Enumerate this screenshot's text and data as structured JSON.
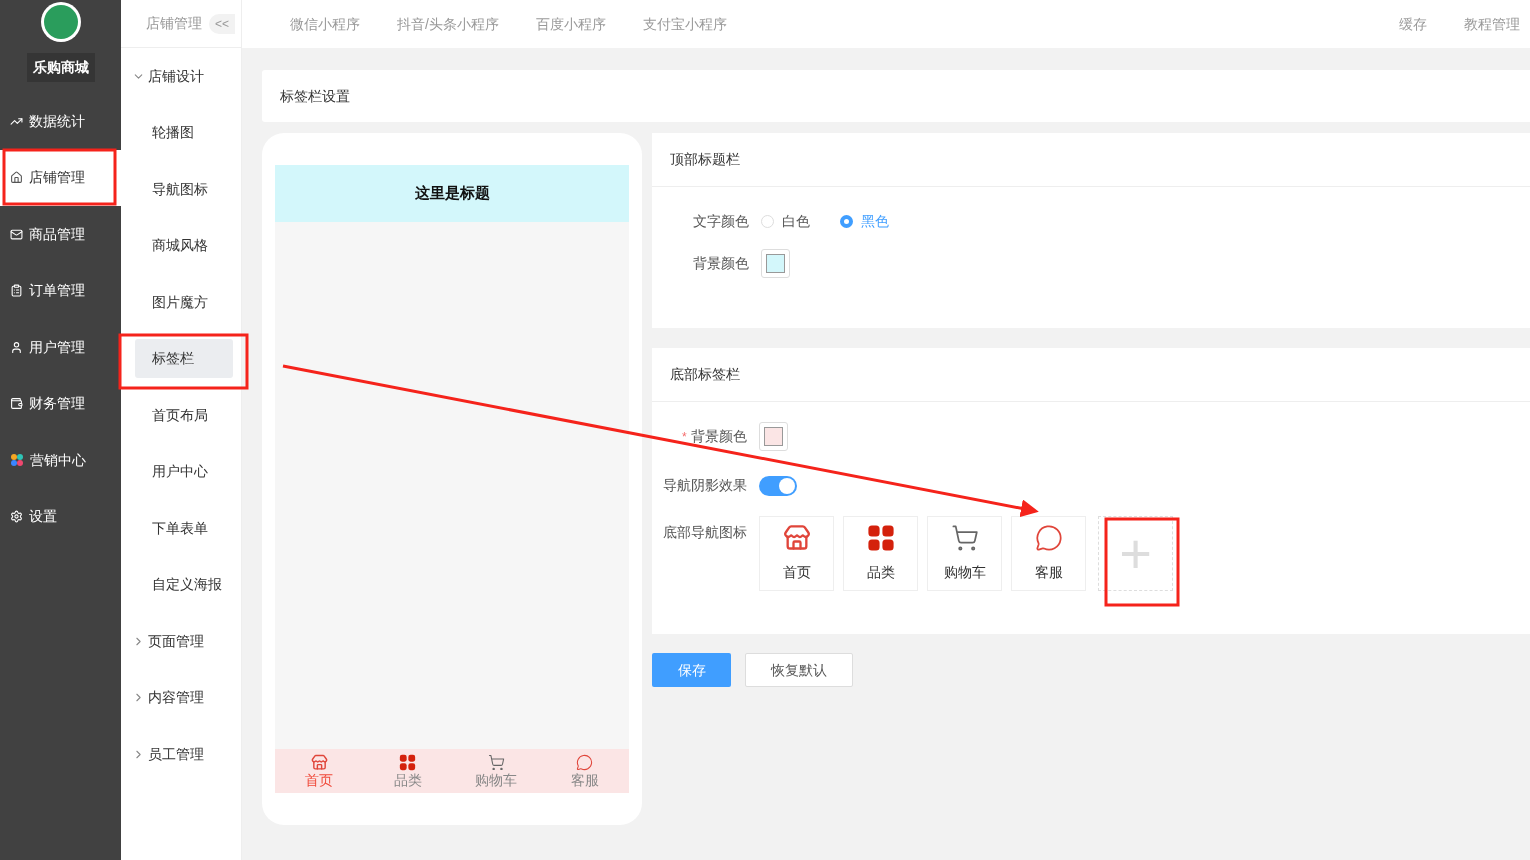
{
  "sidebar": {
    "brand": "乐购商城",
    "items": [
      {
        "label": "数据统计",
        "kind": "chart",
        "selected": false
      },
      {
        "label": "店铺管理",
        "kind": "shop",
        "selected": true
      },
      {
        "label": "商品管理",
        "kind": "mail",
        "selected": false
      },
      {
        "label": "订单管理",
        "kind": "list",
        "selected": false
      },
      {
        "label": "用户管理",
        "kind": "user",
        "selected": false
      },
      {
        "label": "财务管理",
        "kind": "wallet",
        "selected": false
      },
      {
        "label": "营销中心",
        "kind": "flower",
        "selected": false
      },
      {
        "label": "设置",
        "kind": "gear",
        "selected": false
      }
    ]
  },
  "subnav": {
    "title": "店铺管理",
    "collapse": "<<",
    "groups": [
      {
        "label": "店铺设计",
        "expanded": true,
        "children": [
          {
            "label": "轮播图",
            "selected": false
          },
          {
            "label": "导航图标",
            "selected": false
          },
          {
            "label": "商城风格",
            "selected": false
          },
          {
            "label": "图片魔方",
            "selected": false
          },
          {
            "label": "标签栏",
            "selected": true
          },
          {
            "label": "首页布局",
            "selected": false
          },
          {
            "label": "用户中心",
            "selected": false
          },
          {
            "label": "下单表单",
            "selected": false
          },
          {
            "label": "自定义海报",
            "selected": false
          }
        ]
      },
      {
        "label": "页面管理",
        "expanded": false
      },
      {
        "label": "内容管理",
        "expanded": false
      },
      {
        "label": "员工管理",
        "expanded": false
      }
    ]
  },
  "top_tabs": [
    "微信小程序",
    "抖音/头条小程序",
    "百度小程序",
    "支付宝小程序"
  ],
  "top_links": [
    "缓存",
    "教程管理"
  ],
  "page_title": "标签栏设置",
  "preview": {
    "title": "这里是标题",
    "nav": [
      {
        "label": "首页",
        "kind": "store",
        "selected": true
      },
      {
        "label": "品类",
        "kind": "grid",
        "selected": false
      },
      {
        "label": "购物车",
        "kind": "cart",
        "selected": false
      },
      {
        "label": "客服",
        "kind": "chat",
        "selected": false
      }
    ]
  },
  "title_bar": {
    "heading": "顶部标题栏",
    "text_color_label": "文字颜色",
    "text_color_options": [
      {
        "label": "白色",
        "selected": false
      },
      {
        "label": "黑色",
        "selected": true
      }
    ],
    "bg_label": "背景颜色",
    "color": "#d3f7fb"
  },
  "tab_bar": {
    "heading": "底部标签栏",
    "required_mark": "*",
    "bg_label": "背景颜色",
    "color": "#fbe5e5",
    "shadow_label": "导航阴影效果",
    "shadow_on": true,
    "icons_label": "底部导航图标",
    "icons": [
      {
        "label": "首页",
        "kind": "store"
      },
      {
        "label": "品类",
        "kind": "grid"
      },
      {
        "label": "购物车",
        "kind": "cart"
      },
      {
        "label": "客服",
        "kind": "chat"
      }
    ],
    "add_label": "+"
  },
  "buttons": [
    {
      "label": "保存",
      "kind": "primary"
    },
    {
      "label": "恢复默认",
      "kind": "default"
    }
  ]
}
